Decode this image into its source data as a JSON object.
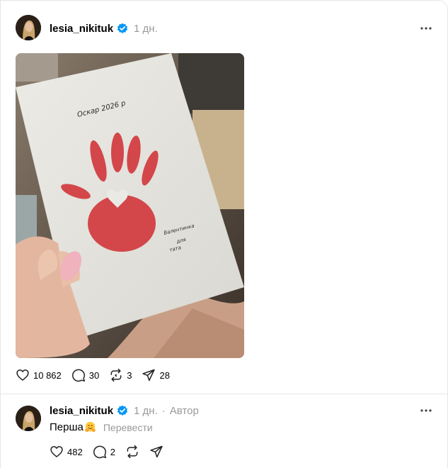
{
  "post": {
    "username": "lesia_nikituk",
    "time": "1 дн.",
    "image": {
      "card_line1": "Оскар 2026 р",
      "card_line2": "Валентинка",
      "card_line3": "для",
      "card_line4": "тата"
    },
    "actions": {
      "likes": "10 862",
      "comments": "30",
      "reposts": "3",
      "shares": "28"
    }
  },
  "reply": {
    "username": "lesia_nikituk",
    "time": "1 дн.",
    "separator": "·",
    "author_label": "Автор",
    "text": "Перша",
    "emoji": "hugging-face",
    "translate_label": "Перевести",
    "actions": {
      "likes": "482",
      "comments": "2"
    }
  },
  "colors": {
    "verified": "#0095f6",
    "muted_text": "#999999",
    "divider": "#e6e6e6",
    "handprint": "#d23a3e"
  }
}
